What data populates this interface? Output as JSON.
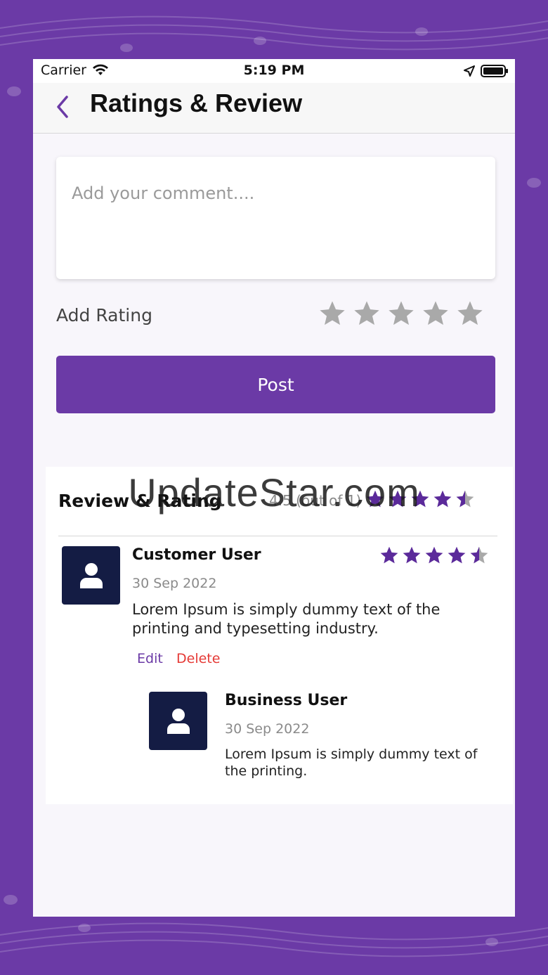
{
  "status_bar": {
    "carrier": "Carrier",
    "time": "5:19 PM"
  },
  "header": {
    "title": "Ratings & Review"
  },
  "comment": {
    "placeholder": "Add your comment...."
  },
  "add_rating": {
    "label": "Add Rating",
    "selected": 0,
    "max": 5
  },
  "post_button": {
    "label": "Post"
  },
  "review_summary": {
    "title": "Review & Rating",
    "average_text": "4.5 (out of 1)",
    "average": 4.5
  },
  "reviews": [
    {
      "name": "Customer User",
      "date": "30 Sep 2022",
      "text_line1": "Lorem Ipsum is simply dummy text of the",
      "text_line2": "printing and typesetting industry.",
      "rating": 4.5,
      "edit_label": "Edit",
      "delete_label": "Delete",
      "reply": {
        "name": "Business User",
        "date": "30 Sep 2022",
        "text_line1": "Lorem Ipsum is simply dummy text of",
        "text_line2": "the printing."
      }
    }
  ],
  "watermark": "UpdateStar.com",
  "colors": {
    "brand": "#6b3aa6",
    "star_empty": "#a9a9a9",
    "star_filled": "#5b2a9a",
    "delete": "#e53935",
    "avatar": "#141c44"
  }
}
